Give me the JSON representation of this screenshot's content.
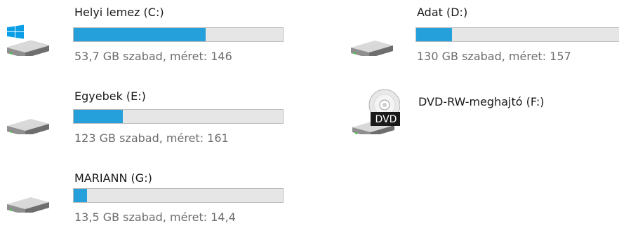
{
  "drives": [
    {
      "label": "Helyi lemez (C:)",
      "info": "53,7 GB szabad, méret: 146",
      "used_fraction": 0.632,
      "system_drive": true,
      "icon": "windows-drive-icon"
    },
    {
      "label": "Adat (D:)",
      "info": "130 GB szabad, méret: 157",
      "used_fraction": 0.172,
      "icon": "hard-drive-icon"
    },
    {
      "label": "Egyebek (E:)",
      "info": "123 GB szabad, méret: 161",
      "used_fraction": 0.236,
      "icon": "hard-drive-icon"
    },
    {
      "label": "DVD-RW-meghajtó (F:)",
      "icon": "dvd-drive-icon",
      "dvd_badge": "DVD"
    },
    {
      "label": "MARIANN (G:)",
      "info": "13,5 GB szabad, méret: 14,4",
      "used_fraction": 0.0625,
      "icon": "hard-drive-icon"
    }
  ],
  "colors": {
    "bar_fill": "#26a0da",
    "bar_track": "#e6e6e6",
    "info_text": "#6d6d6d",
    "windows_logo": "#0a9ee6",
    "drive_led": "#3cd43c"
  }
}
